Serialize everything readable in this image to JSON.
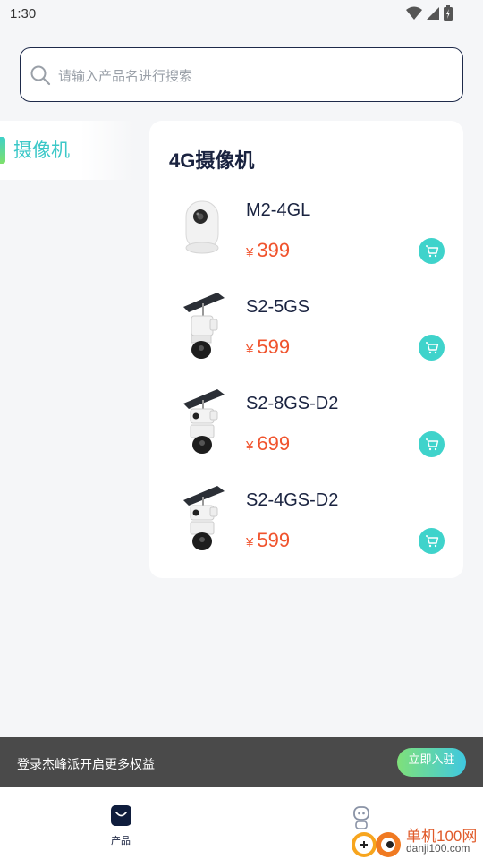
{
  "status_bar": {
    "time": "1:30"
  },
  "search": {
    "placeholder": "请输入产品名进行搜索"
  },
  "sidebar": {
    "items": [
      {
        "label": "摄像机",
        "selected": true
      }
    ]
  },
  "product_section": {
    "title": "4G摄像机",
    "products": [
      {
        "name": "M2-4GL",
        "currency": "¥",
        "price": "399",
        "image": "indoor-dome-camera"
      },
      {
        "name": "S2-5GS",
        "currency": "¥",
        "price": "599",
        "image": "solar-camera"
      },
      {
        "name": "S2-8GS-D2",
        "currency": "¥",
        "price": "699",
        "image": "solar-dual-lens-camera"
      },
      {
        "name": "S2-4GS-D2",
        "currency": "¥",
        "price": "599",
        "image": "solar-dual-lens-camera"
      }
    ]
  },
  "login_banner": {
    "text": "登录杰峰派开启更多权益",
    "button_label": "立即入驻"
  },
  "tab_bar": {
    "tabs": [
      {
        "label": "产品",
        "icon": "shopping-bag-icon",
        "active": true
      }
    ]
  },
  "watermark": {
    "text_cn": "单机100网",
    "text_en": "danji100.com"
  },
  "colors": {
    "accent": "#3fd3cb",
    "price": "#f0532d",
    "dark": "#1a2340",
    "banner": "#4a4a4a"
  }
}
